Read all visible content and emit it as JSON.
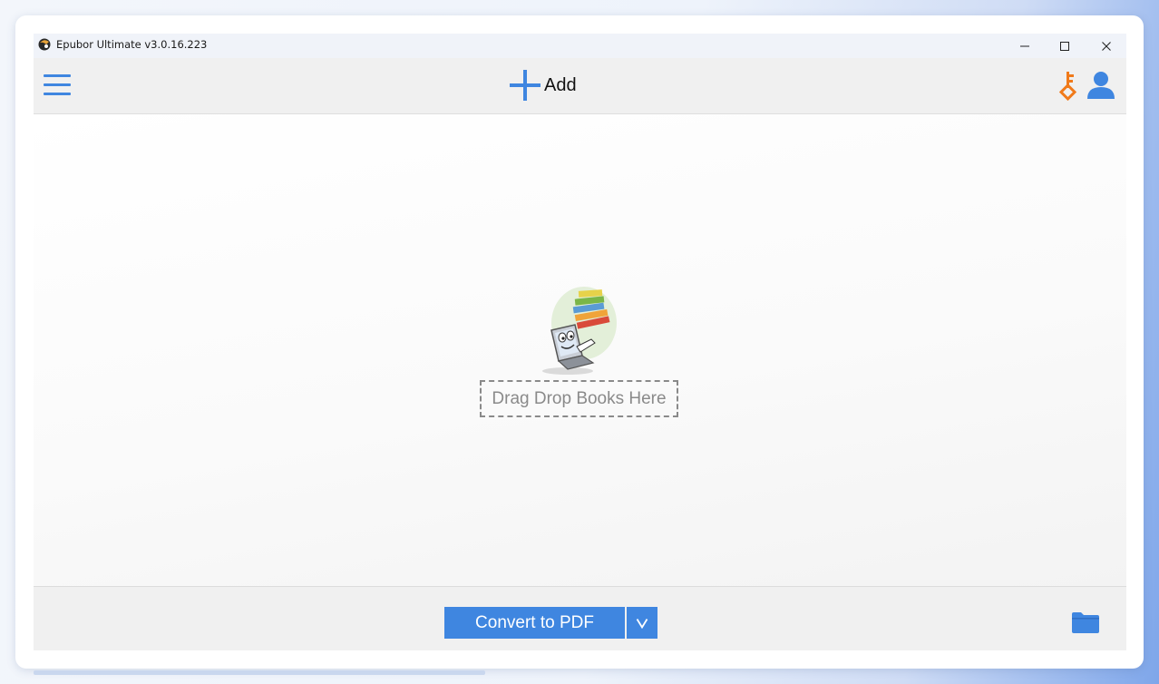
{
  "window": {
    "title": "Epubor Ultimate v3.0.16.223",
    "controls": [
      "minimize",
      "maximize",
      "close"
    ]
  },
  "toolbar": {
    "menu_icon": "hamburger-menu-icon",
    "add_label": "Add",
    "add_icon": "plus-icon",
    "key_icon": "key-icon",
    "user_icon": "user-icon"
  },
  "drop_zone": {
    "label": "Drag Drop Books Here",
    "illustration": "laptop-with-books-illustration"
  },
  "bottom": {
    "convert_label": "Convert to PDF",
    "dropdown_icon": "chevron-down-icon",
    "folder_icon": "folder-icon"
  },
  "colors": {
    "accent_blue": "#3f86e0",
    "key_orange": "#f07a1a",
    "toolbar_bg": "#f0f0f0",
    "titlebar_bg": "#f0f3f9"
  }
}
